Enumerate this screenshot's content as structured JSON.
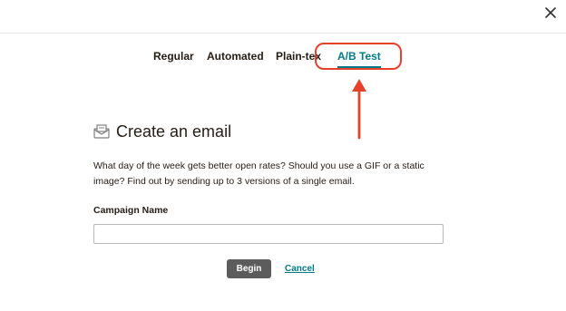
{
  "header": {
    "close_icon": "close-icon"
  },
  "tabs": [
    {
      "label": "Regular",
      "active": false
    },
    {
      "label": "Automated",
      "active": false
    },
    {
      "label": "Plain-tex",
      "active": false
    },
    {
      "label": "A/B Test",
      "active": true
    }
  ],
  "annotation": {
    "highlight_color": "#e8412b",
    "shapes": [
      "rounded-rectangle-highlight",
      "arrow-up"
    ]
  },
  "main": {
    "icon": "envelope-icon",
    "title": "Create an email",
    "description_line1": "What day of the week gets better open rates? Should you use a GIF or a static",
    "description_line2": "image? Find out by sending up to 3 versions of a single email.",
    "campaign_label": "Campaign Name",
    "campaign_value": "",
    "campaign_placeholder": ""
  },
  "actions": {
    "begin_label": "Begin",
    "cancel_label": "Cancel"
  },
  "colors": {
    "accent": "#007c89",
    "primary_button": "#5c5c5c",
    "text": "#241c15",
    "annotation": "#e8412b"
  }
}
